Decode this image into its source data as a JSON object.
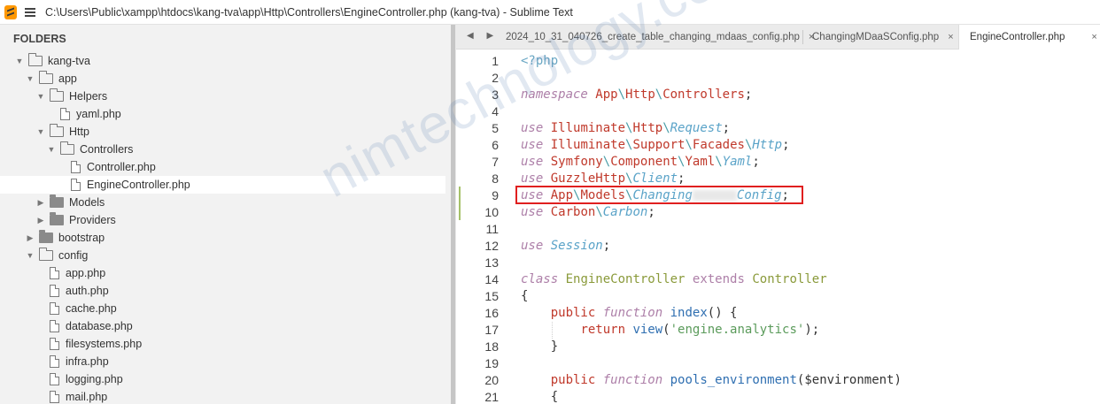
{
  "window": {
    "title": "C:\\Users\\Public\\xampp\\htdocs\\kang-tva\\app\\Http\\Controllers\\EngineController.php (kang-tva) - Sublime Text"
  },
  "sidebar": {
    "header": "FOLDERS",
    "items": [
      {
        "label": "kang-tva",
        "type": "folder",
        "open": true,
        "depth": 0
      },
      {
        "label": "app",
        "type": "folder",
        "open": true,
        "depth": 1
      },
      {
        "label": "Helpers",
        "type": "folder",
        "open": true,
        "depth": 2
      },
      {
        "label": "yaml.php",
        "type": "file",
        "depth": 3
      },
      {
        "label": "Http",
        "type": "folder",
        "open": true,
        "depth": 2
      },
      {
        "label": "Controllers",
        "type": "folder",
        "open": true,
        "depth": 3
      },
      {
        "label": "Controller.php",
        "type": "file",
        "depth": 4
      },
      {
        "label": "EngineController.php",
        "type": "file",
        "depth": 4,
        "selected": true
      },
      {
        "label": "Models",
        "type": "folder",
        "open": false,
        "depth": 2
      },
      {
        "label": "Providers",
        "type": "folder",
        "open": false,
        "depth": 2
      },
      {
        "label": "bootstrap",
        "type": "folder",
        "open": false,
        "depth": 1
      },
      {
        "label": "config",
        "type": "folder",
        "open": true,
        "depth": 1
      },
      {
        "label": "app.php",
        "type": "file",
        "depth": 2
      },
      {
        "label": "auth.php",
        "type": "file",
        "depth": 2
      },
      {
        "label": "cache.php",
        "type": "file",
        "depth": 2
      },
      {
        "label": "database.php",
        "type": "file",
        "depth": 2
      },
      {
        "label": "filesystems.php",
        "type": "file",
        "depth": 2
      },
      {
        "label": "infra.php",
        "type": "file",
        "depth": 2
      },
      {
        "label": "logging.php",
        "type": "file",
        "depth": 2
      },
      {
        "label": "mail.php",
        "type": "file",
        "depth": 2
      }
    ]
  },
  "tabs": [
    {
      "label": "2024_10_31_040726_create_table_changing_mdaas_config.php",
      "close": "×",
      "active": false
    },
    {
      "label": "ChangingMDaaSConfig.php",
      "close": "×",
      "active": false
    },
    {
      "label": "EngineController.php",
      "close": "×",
      "active": true
    }
  ],
  "tab_nav": "◀ ▶",
  "editor": {
    "line_numbers": [
      "1",
      "2",
      "3",
      "4",
      "5",
      "6",
      "7",
      "8",
      "9",
      "10",
      "11",
      "12",
      "13",
      "14",
      "15",
      "16",
      "17",
      "18",
      "19",
      "20",
      "21"
    ],
    "code": {
      "l1": "<?php",
      "l3_kw": "namespace",
      "l3_a": "App",
      "l3_b": "Http",
      "l3_c": "Controllers",
      "l3_end": ";",
      "l5_kw": "use",
      "l5_a": "Illuminate",
      "l5_b": "Http",
      "l5_c": "Request",
      "l6_kw": "use",
      "l6_a": "Illuminate",
      "l6_b": "Support",
      "l6_c": "Facades",
      "l6_d": "Http",
      "l7_kw": "use",
      "l7_a": "Symfony",
      "l7_b": "Component",
      "l7_c": "Yaml",
      "l7_d": "Yaml",
      "l8_kw": "use",
      "l8_a": "GuzzleHttp",
      "l8_b": "Client",
      "l9_kw": "use",
      "l9_a": "App",
      "l9_b": "Models",
      "l9_c1": "Changing",
      "l9_c2": "Config",
      "l10_kw": "use",
      "l10_a": "Carbon",
      "l10_b": "Carbon",
      "l12_kw": "use",
      "l12_a": "Session",
      "l14_kw": "class",
      "l14_name": "EngineController",
      "l14_ext": "extends",
      "l14_parent": "Controller",
      "l15": "{",
      "l16_pub": "public",
      "l16_fn": "function",
      "l16_name": "index",
      "l16_rest": "() {",
      "l17_ret": "return",
      "l17_fn": "view",
      "l17_str": "'engine.analytics'",
      "l18": "}",
      "l20_pub": "public",
      "l20_fn": "function",
      "l20_name": "pools_environment",
      "l20_arg": "($environment)",
      "l21": "{"
    }
  },
  "watermark": "nimtechnology.com"
}
